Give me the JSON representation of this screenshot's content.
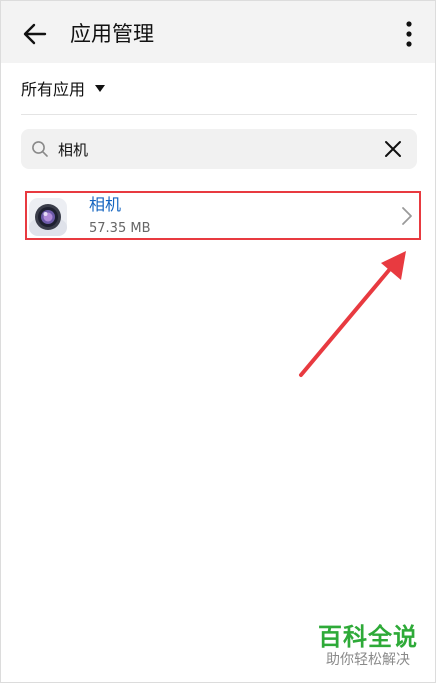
{
  "header": {
    "title": "应用管理",
    "back_icon": "arrow-left-icon",
    "more_icon": "more-vertical-icon"
  },
  "filter": {
    "label": "所有应用",
    "arrow_icon": "triangle-down-icon"
  },
  "search": {
    "value": "相机",
    "icon": "search-icon",
    "clear_icon": "close-icon"
  },
  "apps": [
    {
      "name": "相机",
      "size": "57.35 MB",
      "icon": "camera-app-icon"
    }
  ],
  "annotation": {
    "color": "#e83a40"
  },
  "watermark": {
    "title": "百科全说",
    "subtitle": "助你轻松解决",
    "color": "#2eaa38"
  }
}
